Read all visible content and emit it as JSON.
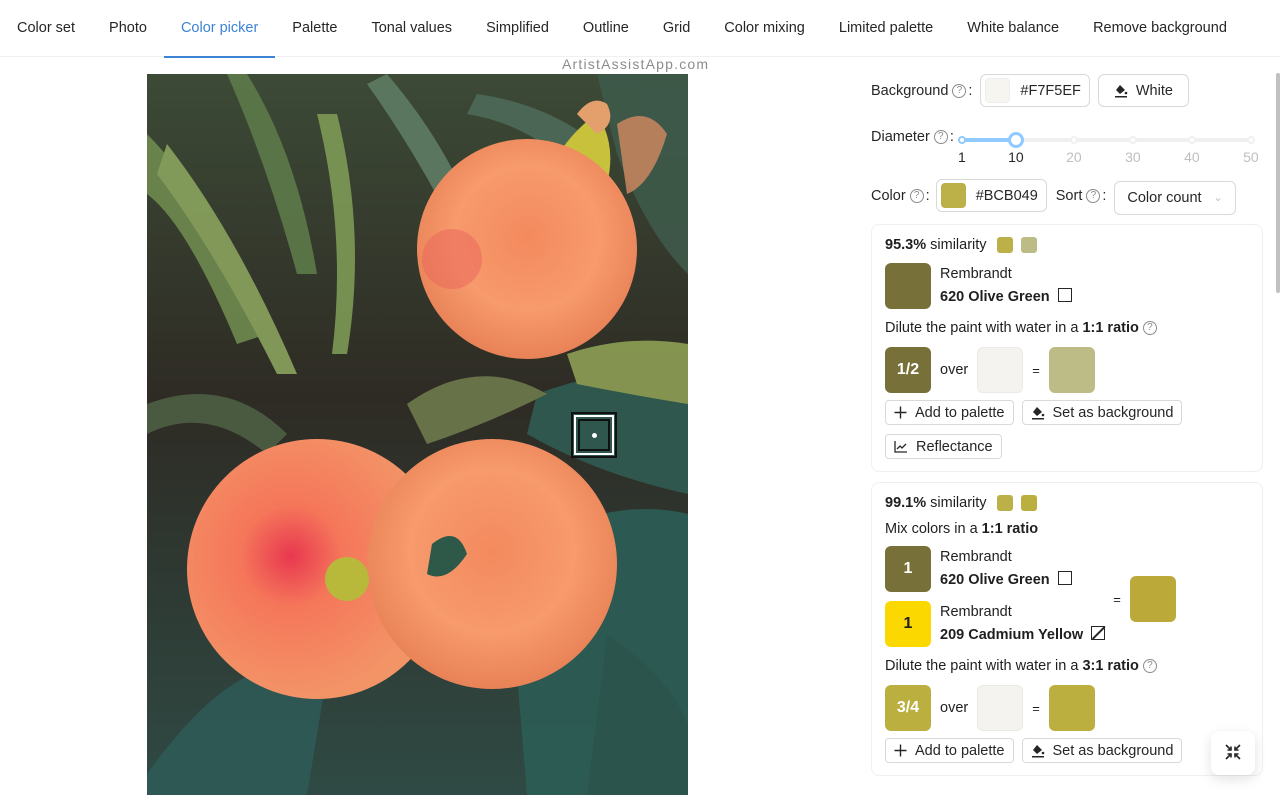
{
  "tabs": [
    {
      "label": "Color set",
      "active": false
    },
    {
      "label": "Photo",
      "active": false
    },
    {
      "label": "Color picker",
      "active": true
    },
    {
      "label": "Palette",
      "active": false
    },
    {
      "label": "Tonal values",
      "active": false
    },
    {
      "label": "Simplified",
      "active": false
    },
    {
      "label": "Outline",
      "active": false
    },
    {
      "label": "Grid",
      "active": false
    },
    {
      "label": "Color mixing",
      "active": false
    },
    {
      "label": "Limited palette",
      "active": false
    },
    {
      "label": "White balance",
      "active": false
    },
    {
      "label": "Remove background",
      "active": false
    }
  ],
  "watermark": "ArtistAssistApp.com",
  "photo": {
    "alt": "Orange dahlias with green foliage",
    "picker_icon": "picker-square-icon"
  },
  "controls": {
    "background": {
      "label": "Background",
      "help": "?",
      "value": "#F7F5EF",
      "swatch": "#F7F5EF",
      "button_label": "White",
      "button_icon": "paint-bucket-icon"
    },
    "diameter": {
      "label": "Diameter",
      "help": "?",
      "value": 10,
      "min": 1,
      "max": 50,
      "marks": [
        "1",
        "10",
        "20",
        "30",
        "40",
        "50"
      ]
    },
    "color": {
      "label": "Color",
      "help": "?",
      "value": "#BCB049",
      "swatch": "#BCB049"
    },
    "sort": {
      "label": "Sort",
      "help": "?",
      "selected": "Color count"
    }
  },
  "results": [
    {
      "similarity": "95.3%",
      "similarity_label": "similarity",
      "swatches": [
        "#BCB049",
        "#BDBC86"
      ],
      "paints": [
        {
          "brand": "Rembrandt",
          "name": "620 Olive Green",
          "color": "#777039",
          "part": "",
          "opacity_icon": "opaque-square-icon"
        }
      ],
      "dilute_text": "Dilute the paint with water in a",
      "dilute_ratio": "1:1 ratio",
      "fraction": "1/2",
      "over_label": "over",
      "fraction_color": "#777039",
      "background_color": "#F5F3EF",
      "result_color": "#BDBC86",
      "buttons": [
        "Add to palette",
        "Set as background",
        "Reflectance"
      ]
    },
    {
      "similarity": "99.1%",
      "similarity_label": "similarity",
      "swatches": [
        "#BCB049",
        "#BBAF40"
      ],
      "mix_text": "Mix colors in a",
      "mix_ratio": "1:1 ratio",
      "paints": [
        {
          "brand": "Rembrandt",
          "name": "620 Olive Green",
          "color": "#777039",
          "part": "1",
          "opacity_icon": "opaque-square-icon"
        },
        {
          "brand": "Rembrandt",
          "name": "209 Cadmium Yellow",
          "color": "#FBD800",
          "part": "1",
          "opacity_icon": "semi-opaque-square-icon"
        }
      ],
      "mix_result_color": "#BBA93A",
      "dilute_text": "Dilute the paint with water in a",
      "dilute_ratio": "3:1 ratio",
      "fraction": "3/4",
      "over_label": "over",
      "fraction_color": "#BBAF40",
      "background_color": "#F5F3EF",
      "result_color": "#BBAF40",
      "buttons": [
        "Add to palette",
        "Set as background"
      ]
    }
  ],
  "fab": {
    "icon": "collapse-icon"
  }
}
